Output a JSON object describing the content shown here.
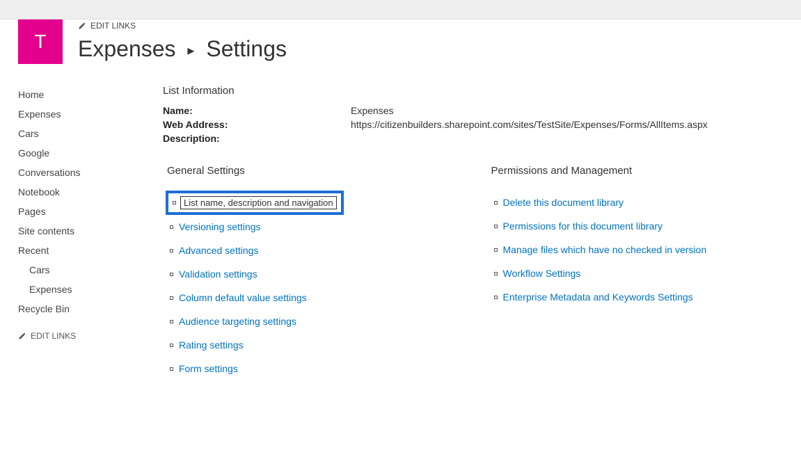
{
  "header": {
    "logo_letter": "T",
    "edit_links_label": "EDIT LINKS",
    "breadcrumb_first": "Expenses",
    "breadcrumb_second": "Settings"
  },
  "nav": {
    "items": [
      {
        "label": "Home"
      },
      {
        "label": "Expenses"
      },
      {
        "label": "Cars"
      },
      {
        "label": "Google"
      },
      {
        "label": "Conversations"
      },
      {
        "label": "Notebook"
      },
      {
        "label": "Pages"
      },
      {
        "label": "Site contents"
      }
    ],
    "recent_header": "Recent",
    "recent_items": [
      {
        "label": "Cars"
      },
      {
        "label": "Expenses"
      }
    ],
    "recycle_bin": "Recycle Bin",
    "edit_links_label": "EDIT LINKS"
  },
  "list_info": {
    "section_title": "List Information",
    "name_label": "Name:",
    "name_value": "Expenses",
    "web_address_label": "Web Address:",
    "web_address_value": "https://citizenbuilders.sharepoint.com/sites/TestSite/Expenses/Forms/AllItems.aspx",
    "description_label": "Description:"
  },
  "general_settings": {
    "title": "General Settings",
    "links": [
      "List name, description and navigation",
      "Versioning settings",
      "Advanced settings",
      "Validation settings",
      "Column default value settings",
      "Audience targeting settings",
      "Rating settings",
      "Form settings"
    ]
  },
  "permissions": {
    "title": "Permissions and Management",
    "links": [
      "Delete this document library",
      "Permissions for this document library",
      "Manage files which have no checked in version",
      "Workflow Settings",
      "Enterprise Metadata and Keywords Settings"
    ]
  }
}
